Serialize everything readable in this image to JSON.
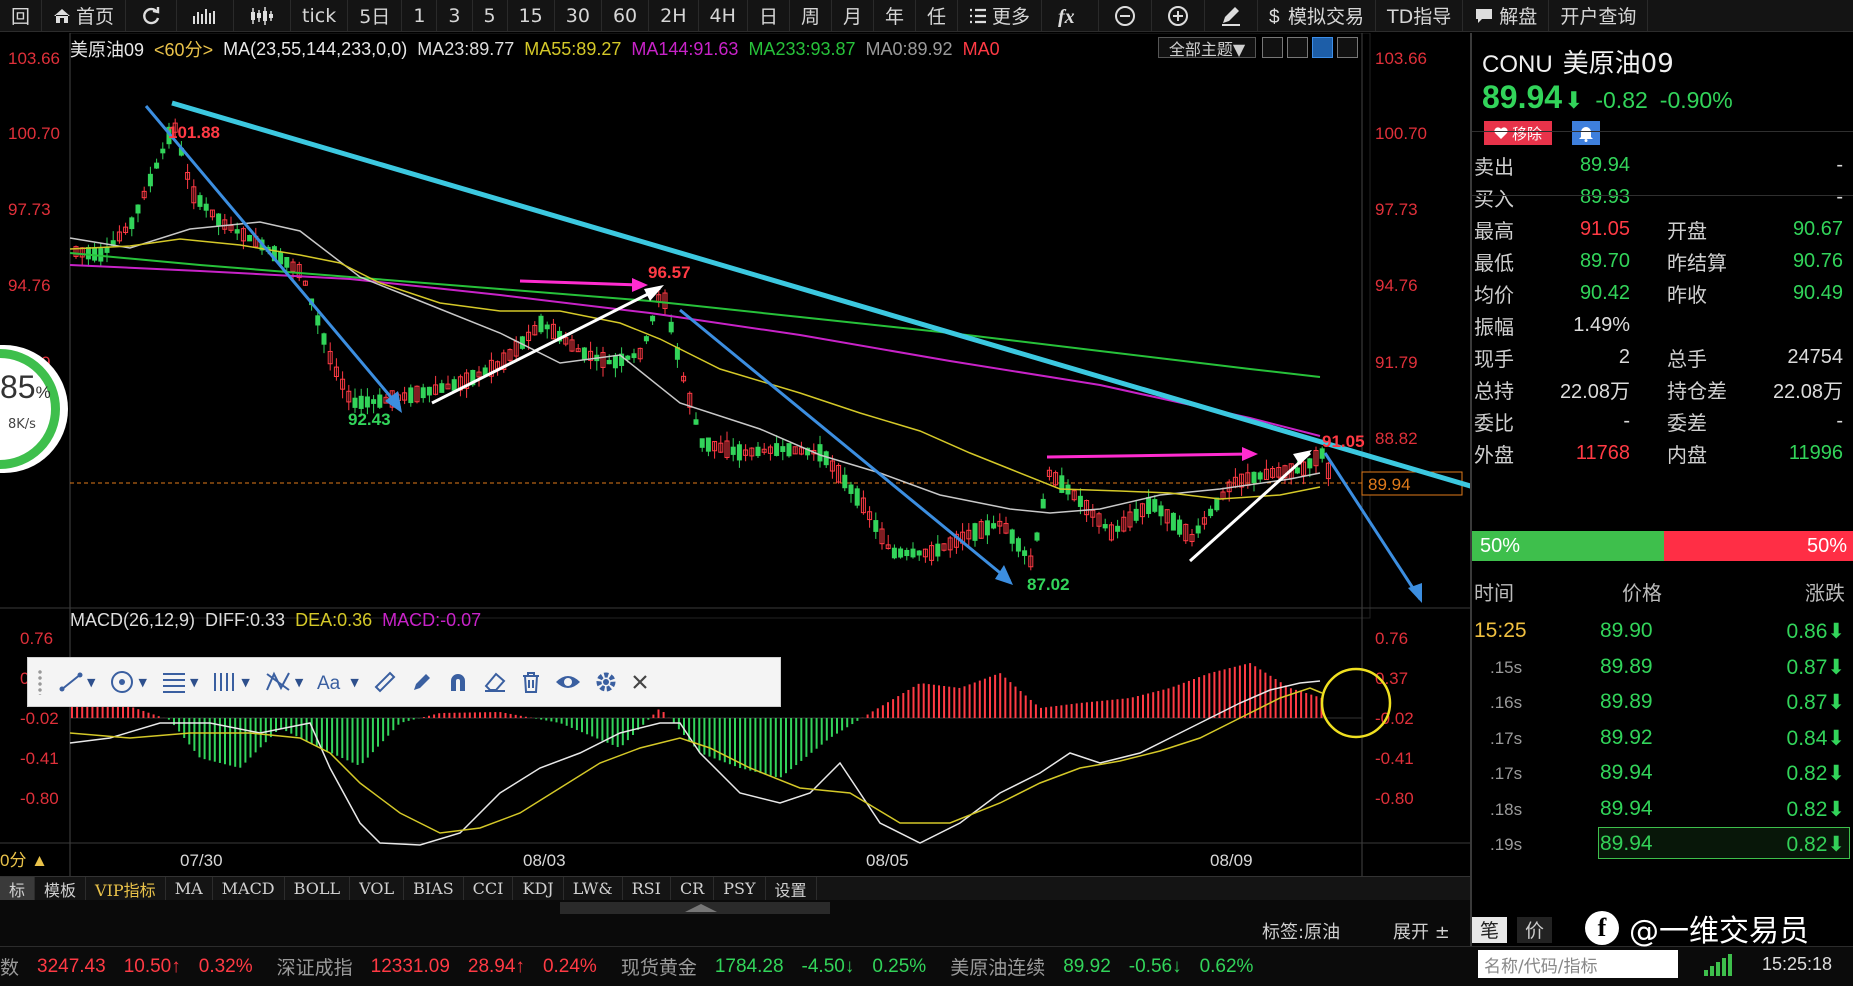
{
  "toolbar": {
    "items": [
      "首页",
      "",
      "",
      "",
      "tick",
      "5日",
      "1",
      "3",
      "5",
      "15",
      "30",
      "60",
      "2H",
      "4H",
      "日",
      "周",
      "月",
      "年",
      "任",
      "更多",
      "",
      "",
      "",
      "",
      "模拟交易",
      "TD指导",
      "解盘",
      "开户查询"
    ],
    "first_cut": "回"
  },
  "legend": {
    "symbol": "美原油09",
    "period": "<60分>",
    "ma_def": "MA(23,55,144,233,0,0)",
    "ma23": "MA23:89.77",
    "ma55": "MA55:89.27",
    "ma144": "MA144:91.63",
    "ma233": "MA233:93.87",
    "ma0a": "MA0:89.92",
    "ma0b": "MA0",
    "theme": "全部主题▼"
  },
  "colors": {
    "up": "#ff3a44",
    "down": "#32d45a",
    "ma23": "#d4c828",
    "ma55": "#c8c8c8",
    "ma144": "#c823c8",
    "ma233": "#27c23a",
    "trend": "#3cc8e0",
    "arrow_blue": "#3c8ee0",
    "arrow_magenta": "#ff2cd0"
  },
  "price_axis": [
    "103.66",
    "100.70",
    "97.73",
    "94.76",
    "91.79",
    "88.82"
  ],
  "current_price_tag": "89.94",
  "annotations": {
    "high": "101.88",
    "peak2": "96.57",
    "low1": "92.43",
    "low2": "87.02",
    "last_high": "91.05"
  },
  "macd": {
    "label": "MACD(26,12,9)",
    "diff": "DIFF:0.33",
    "dea": "DEA:0.36",
    "macd": "MACD:-0.07",
    "axis": [
      "0.76",
      "0.37",
      "-0.02",
      "-0.41",
      "-0.80"
    ]
  },
  "dates": [
    "07/30",
    "08/03",
    "08/05",
    "08/09"
  ],
  "period_indicator": "0分 ▲",
  "gauge": {
    "pct": "85",
    "unit": "%",
    "speed": "8K/s"
  },
  "tabs": [
    "标",
    "模板",
    "VIP指标",
    "MA",
    "MACD",
    "BOLL",
    "VOL",
    "BIAS",
    "CCI",
    "KDJ",
    "LW&",
    "RSI",
    "CR",
    "PSY",
    "设置"
  ],
  "tag_label": "标签:原油",
  "expand": "展开 ±",
  "status": {
    "i1_label": "数",
    "i1_val": "3247.43",
    "i1_chg": "10.50↑",
    "i1_pct": "0.32%",
    "i2_label": "深证成指",
    "i2_val": "12331.09",
    "i2_chg": "28.94↑",
    "i2_pct": "0.24%",
    "i3_label": "现货黄金",
    "i3_val": "1784.28",
    "i3_chg": "-4.50↓",
    "i3_pct": "0.25%",
    "i4_label": "美原油连续",
    "i4_val": "89.92",
    "i4_chg": "-0.56↓",
    "i4_pct": "0.62%"
  },
  "panel": {
    "code": "CONU",
    "name": "美原油09",
    "price": "89.94",
    "arrow": "⬇",
    "change": "-0.82",
    "change_pct": "-0.90%",
    "remove": "移除",
    "quotes": [
      {
        "k": "卖出",
        "v": "89.94",
        "k2": "",
        "v2": "-"
      },
      {
        "k": "买入",
        "v": "89.93",
        "k2": "",
        "v2": "-"
      },
      {
        "k": "最高",
        "v": "91.05",
        "k2": "开盘",
        "v2": "90.67"
      },
      {
        "k": "最低",
        "v": "89.70",
        "k2": "昨结算",
        "v2": "90.76"
      },
      {
        "k": "均价",
        "v": "90.42",
        "k2": "昨收",
        "v2": "90.49"
      },
      {
        "k": "振幅",
        "v": "1.49%",
        "k2": "",
        "v2": ""
      },
      {
        "k": "现手",
        "v": "2",
        "k2": "总手",
        "v2": "24754"
      },
      {
        "k": "总持",
        "v": "22.08万",
        "k2": "持仓差",
        "v2": "22.08万"
      },
      {
        "k": "委比",
        "v": "-",
        "k2": "委差",
        "v2": "-"
      },
      {
        "k": "外盘",
        "v": "11768",
        "k2": "内盘",
        "v2": "11996"
      }
    ],
    "buy_pct": "50%",
    "sell_pct": "50%",
    "tick_head": {
      "time": "时间",
      "price": "价格",
      "chg": "涨跌"
    },
    "ticks": [
      {
        "t": "15:25",
        "p": "89.90",
        "c": "0.86⬇"
      },
      {
        "t": ".15s",
        "p": "89.89",
        "c": "0.87⬇"
      },
      {
        "t": ".16s",
        "p": "89.89",
        "c": "0.87⬇"
      },
      {
        "t": ".17s",
        "p": "89.92",
        "c": "0.84⬇"
      },
      {
        "t": ".17s",
        "p": "89.94",
        "c": "0.82⬇"
      },
      {
        "t": ".18s",
        "p": "89.94",
        "c": "0.82⬇"
      },
      {
        "t": ".19s",
        "p": "89.94",
        "c": "0.82⬇"
      }
    ],
    "tab_bi": "笔",
    "tab_jia": "价",
    "search_placeholder": "名称/代码/指标",
    "clock": "15:25:18"
  },
  "watermark": "@一维交易员"
}
